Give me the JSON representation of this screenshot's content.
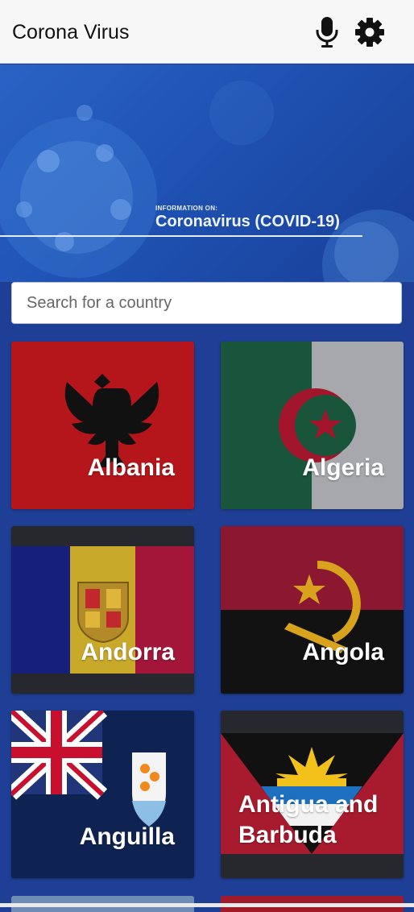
{
  "header": {
    "title": "Corona Virus",
    "mic_icon": "microphone-icon",
    "settings_icon": "gear-icon"
  },
  "banner": {
    "subtitle": "INFORMATION ON:",
    "title": "Coronavirus (COVID-19)"
  },
  "search": {
    "placeholder": "Search for a country",
    "value": ""
  },
  "countries": [
    {
      "name": "Albania"
    },
    {
      "name": "Algeria"
    },
    {
      "name": "Andorra"
    },
    {
      "name": "Angola"
    },
    {
      "name": "Anguilla"
    },
    {
      "name": "Antigua and Barbuda"
    }
  ],
  "colors": {
    "page_background": "#1f3f96",
    "topbar_background": "#f7f7f8"
  }
}
